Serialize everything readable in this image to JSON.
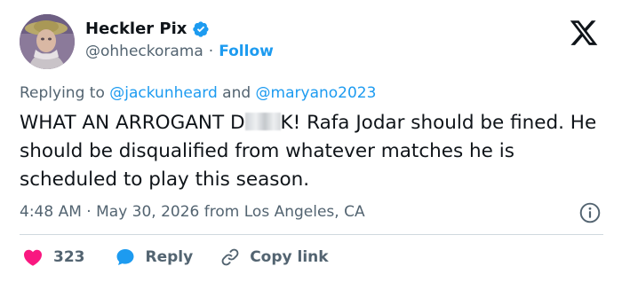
{
  "author": {
    "display_name": "Heckler Pix",
    "handle": "@ohheckorama",
    "separator": "·",
    "follow_label": "Follow",
    "avatar": "avatar-photo",
    "verified_icon": "verified-badge-icon"
  },
  "brand_icon": "x-logo-icon",
  "reply_context": {
    "prefix": "Replying to",
    "mention_1": "@jackunheard",
    "joiner": "and",
    "mention_2": "@maryano2023"
  },
  "tweet": {
    "text_before_redaction": "WHAT AN ARROGANT D",
    "text_after_redaction": "K! Rafa Jodar should be fined. He should be disqualified from whatever matches he is scheduled to play this season.",
    "time": "4:48 AM",
    "dot": "·",
    "date": "May 30, 2026",
    "location": "from Los Angeles, CA"
  },
  "actions": {
    "like_count": "323",
    "reply_label": "Reply",
    "copy_label": "Copy link"
  },
  "colors": {
    "accent": "#1d9bf0",
    "like": "#f91880",
    "text": "#0f1419",
    "secondary": "#536471",
    "divider": "#cfd9de"
  }
}
